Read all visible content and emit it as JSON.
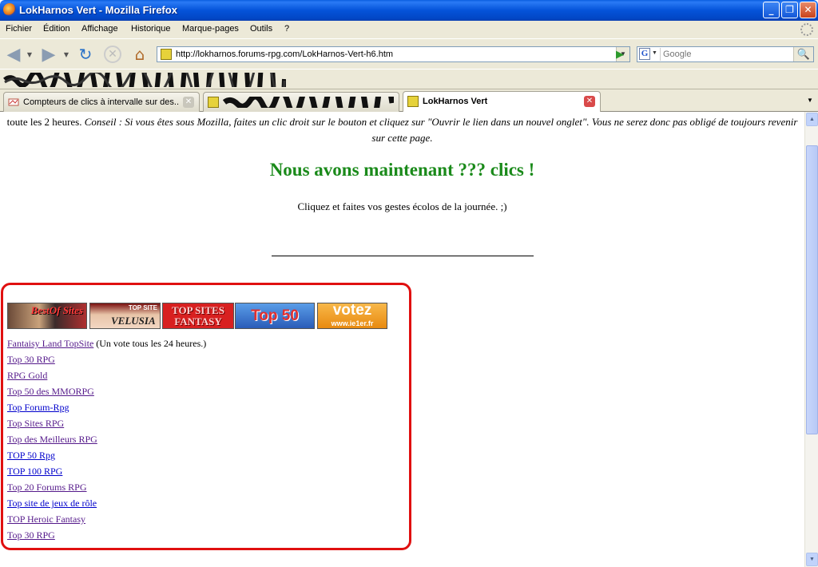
{
  "window": {
    "title": "LokHarnos Vert - Mozilla Firefox",
    "min": "_",
    "max": "❐",
    "close": "✕"
  },
  "menu": [
    "Fichier",
    "Édition",
    "Affichage",
    "Historique",
    "Marque-pages",
    "Outils",
    "?"
  ],
  "nav": {
    "url": "http://lokharnos.forums-rpg.com/LokHarnos-Vert-h6.htm",
    "search_placeholder": "Google",
    "search_engine": "G"
  },
  "tabs": [
    {
      "label": "Compteurs de clics à intervalle sur des...",
      "active": false
    },
    {
      "label": "",
      "active": false,
      "scribbled": true
    },
    {
      "label": "LokHarnos Vert",
      "active": true
    }
  ],
  "content": {
    "intro_plain": "toute les 2 heures.",
    "intro_italic": "Conseil : Si vous êtes sous Mozilla, faites un clic droit sur le bouton et cliquez sur \"Ouvrir le lien dans un nouvel onglet\". Vous ne serez donc pas obligé de toujours revenir sur cette page.",
    "headline": "Nous avons maintenant ??? clics !",
    "subline": "Cliquez et faites vos gestes écolos de la journée. ;)"
  },
  "banners": {
    "b1": "BestOf Sites",
    "b2_top": "TOP SITE",
    "b2_main": "VELUSIA",
    "b3": "TOP SITES FANTASY",
    "b4": "Top 50",
    "b5_main": "votez",
    "b5_sub": "www.ie1er.fr"
  },
  "sites": [
    {
      "label": "Fantaisy Land TopSite",
      "note": "(Un vote tous les 24 heures.)",
      "visited": true
    },
    {
      "label": "Top 30 RPG",
      "visited": true
    },
    {
      "label": "RPG Gold",
      "visited": true
    },
    {
      "label": "Top 50 des MMORPG",
      "visited": true
    },
    {
      "label": "Top Forum-Rpg",
      "visited": false
    },
    {
      "label": "Top Sites RPG",
      "visited": true
    },
    {
      "label": "Top des Meilleurs RPG",
      "visited": true
    },
    {
      "label": "TOP 50 Rpg",
      "visited": false
    },
    {
      "label": "TOP 100 RPG",
      "visited": false
    },
    {
      "label": "Top 20 Forums RPG",
      "visited": true
    },
    {
      "label": "Top site de jeux de rôle",
      "visited": false
    },
    {
      "label": "TOP Heroic Fantasy",
      "visited": true
    },
    {
      "label": "Top 30 RPG",
      "visited": true
    }
  ],
  "colors": {
    "headline": "#1a8a1a",
    "frame": "#e01010",
    "visited_link": "#551a8b",
    "link": "#0000cc"
  }
}
